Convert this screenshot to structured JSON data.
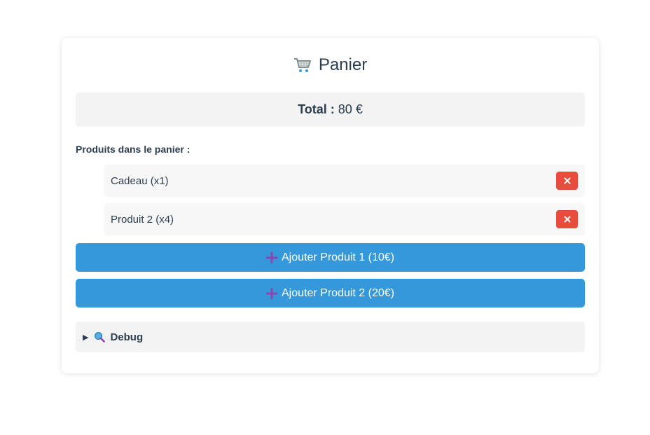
{
  "cart": {
    "title": "Panier",
    "title_icon": "shopping-cart-icon",
    "total_label": "Total :",
    "total_value": "80 €",
    "products_heading": "Produits dans le panier :",
    "items": [
      {
        "label": "Cadeau (x1)",
        "remove_icon": "close-icon"
      },
      {
        "label": "Produit 2 (x4)",
        "remove_icon": "close-icon"
      }
    ],
    "add_buttons": [
      {
        "label": "Ajouter Produit 1 (10€)",
        "icon": "plus-icon"
      },
      {
        "label": "Ajouter Produit 2 (20€)",
        "icon": "plus-icon"
      }
    ],
    "debug_label": "Debug",
    "debug_triangle": "▶"
  },
  "colors": {
    "accent_blue": "#3498db",
    "danger_red": "#e74c3c",
    "plus_purple": "#8e44ad",
    "text_dark": "#2c3e50",
    "panel_gray": "#f3f3f3"
  }
}
